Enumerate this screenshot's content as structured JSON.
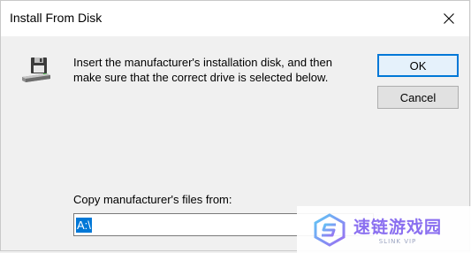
{
  "window": {
    "title": "Install From Disk",
    "close_icon": "close-icon"
  },
  "content": {
    "icon": "floppy-disk-drive-icon",
    "message_line1": "Insert the manufacturer's installation disk, and then",
    "message_line2": "make sure that the correct drive is selected below."
  },
  "buttons": {
    "ok_label": "OK",
    "cancel_label": "Cancel"
  },
  "copy_from": {
    "label": "Copy manufacturer's files from:",
    "value": "A:\\"
  },
  "watermark": {
    "text": "速链游戏园",
    "subtext": "SLINK VIP"
  },
  "colors": {
    "accent": "#0078d7",
    "dialog_bg": "#f0f0f0",
    "titlebar_bg": "#ffffff"
  }
}
